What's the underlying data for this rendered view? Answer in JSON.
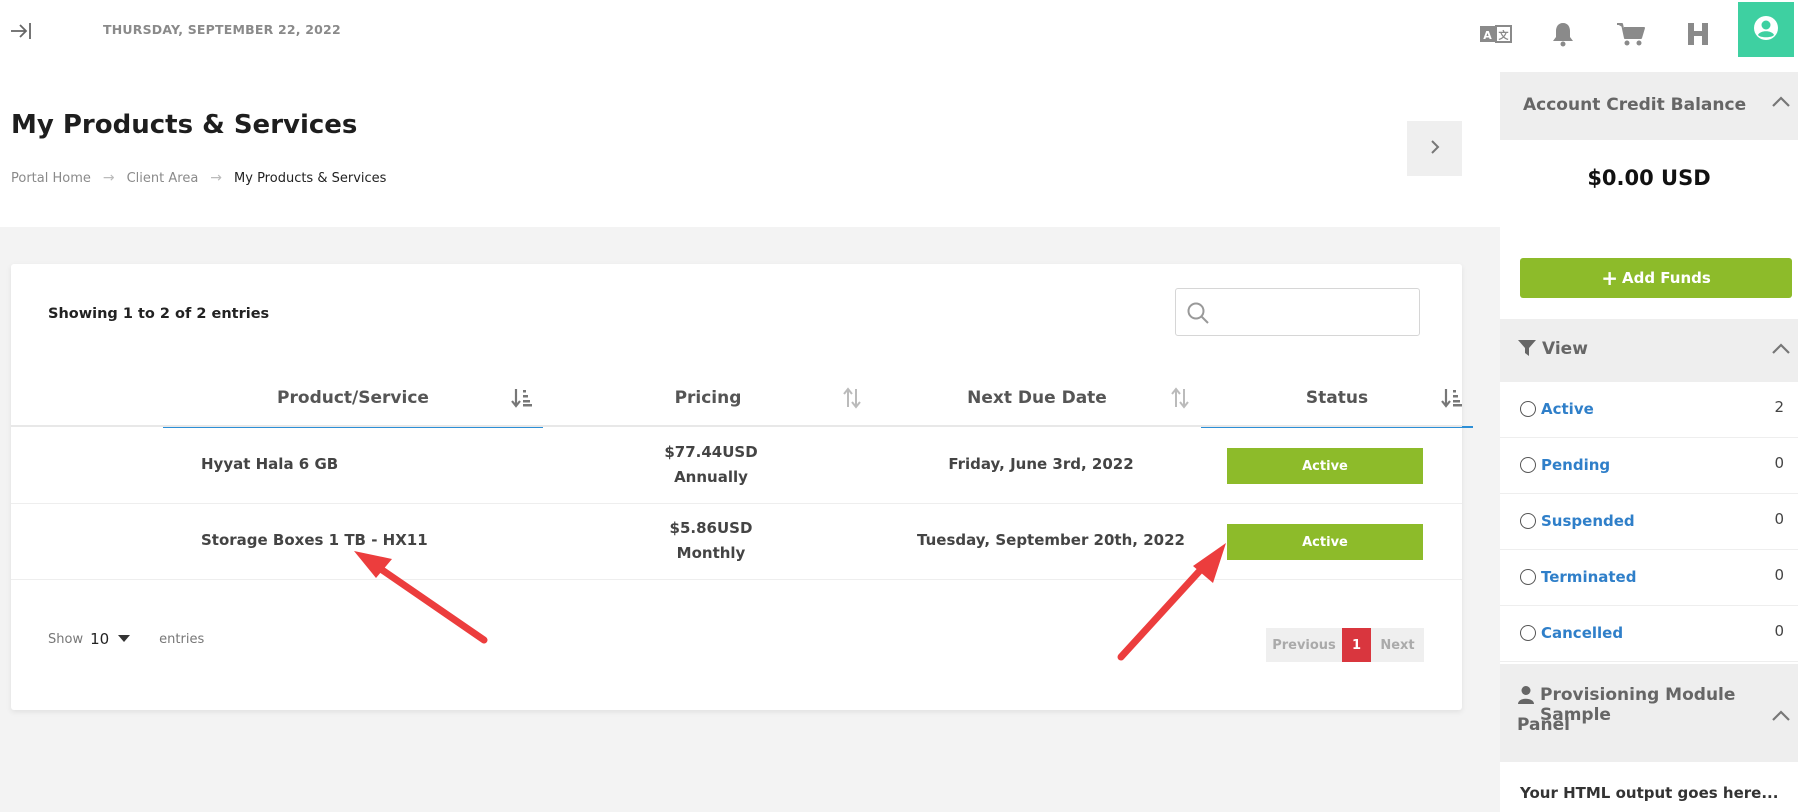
{
  "topbar": {
    "date": "THURSDAY, SEPTEMBER 22, 2022",
    "icons": [
      "collapse-sidebar-icon",
      "translate-icon",
      "bell-icon",
      "cart-icon",
      "h-logo-icon",
      "user-icon"
    ],
    "accent_color": "#3ed0a1"
  },
  "header": {
    "title": "My Products & Services",
    "breadcrumb": [
      "Portal Home",
      "Client Area",
      "My Products & Services"
    ]
  },
  "table": {
    "showing": "Showing 1 to 2 of 2 entries",
    "search_placeholder": "",
    "columns": [
      "Product/Service",
      "Pricing",
      "Next Due Date",
      "Status"
    ],
    "rows": [
      {
        "product": "Hyyat Hala 6 GB",
        "price": "$77.44USD",
        "cycle": "Annually",
        "due": "Friday, June 3rd, 2022",
        "status": "Active"
      },
      {
        "product": "Storage Boxes 1 TB - HX11",
        "price": "$5.86USD",
        "cycle": "Monthly",
        "due": "Tuesday, September 20th, 2022",
        "status": "Active"
      }
    ],
    "show_label": "Show",
    "page_size": "10",
    "entries_label": "entries",
    "pagination": {
      "previous": "Previous",
      "current": "1",
      "next": "Next"
    },
    "status_color": "#8dbb2a",
    "page_color": "#d9363e"
  },
  "sidebar": {
    "credit": {
      "title": "Account Credit Balance",
      "balance": "$0.00 USD",
      "add_funds": "Add Funds"
    },
    "view": {
      "title": "View",
      "filters": [
        {
          "label": "Active",
          "count": "2"
        },
        {
          "label": "Pending",
          "count": "0"
        },
        {
          "label": "Suspended",
          "count": "0"
        },
        {
          "label": "Terminated",
          "count": "0"
        },
        {
          "label": "Cancelled",
          "count": "0"
        }
      ]
    },
    "module": {
      "title_line1": "Provisioning Module Sample",
      "title_line2": "Panel",
      "body": "Your HTML output goes here..."
    }
  },
  "annotations": {
    "arrow_color": "#ec3d3d"
  }
}
